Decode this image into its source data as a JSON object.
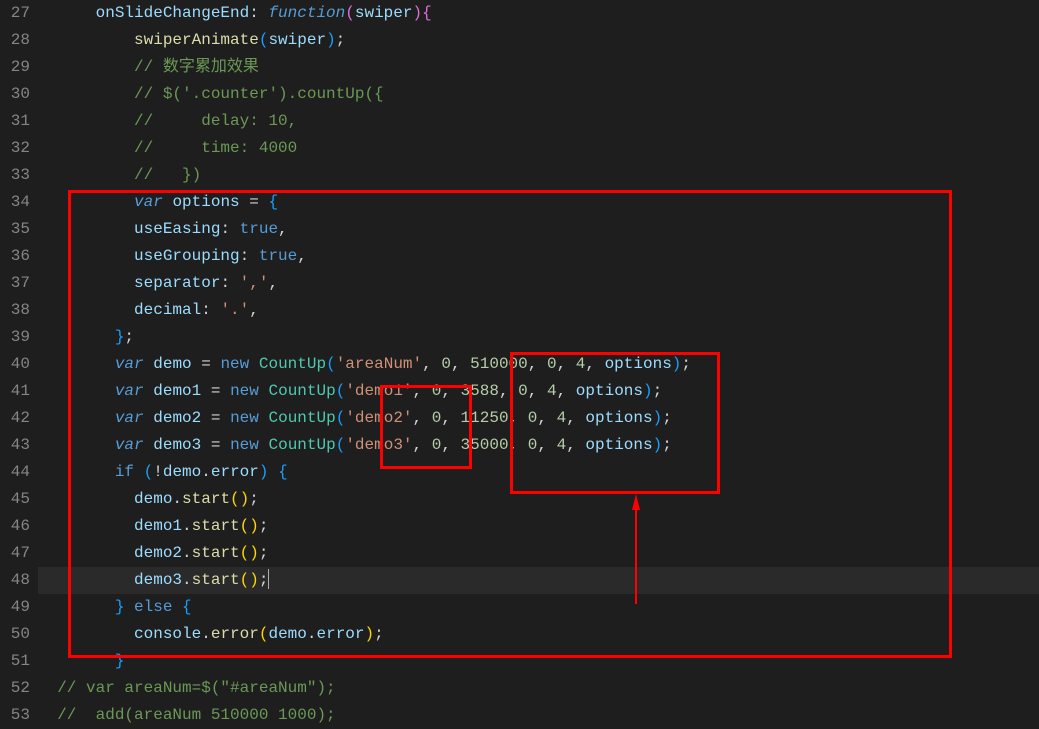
{
  "lines": [
    {
      "num": 27,
      "indent": 3,
      "tokens": [
        {
          "t": "var",
          "c": "onSlideChangeEnd"
        },
        {
          "t": "punc",
          "c": ": "
        },
        {
          "t": "kw",
          "c": "function"
        },
        {
          "t": "paren2",
          "c": "("
        },
        {
          "t": "var",
          "c": "swiper"
        },
        {
          "t": "paren2",
          "c": ")"
        },
        {
          "t": "paren2",
          "c": "{"
        }
      ]
    },
    {
      "num": 28,
      "indent": 5,
      "tokens": [
        {
          "t": "fn",
          "c": "swiperAnimate"
        },
        {
          "t": "paren3",
          "c": "("
        },
        {
          "t": "var",
          "c": "swiper"
        },
        {
          "t": "paren3",
          "c": ")"
        },
        {
          "t": "punc",
          "c": ";"
        }
      ]
    },
    {
      "num": 29,
      "indent": 5,
      "tokens": [
        {
          "t": "com",
          "c": "// 数字累加效果"
        }
      ]
    },
    {
      "num": 30,
      "indent": 5,
      "tokens": [
        {
          "t": "com",
          "c": "// $('.counter').countUp({"
        }
      ]
    },
    {
      "num": 31,
      "indent": 5,
      "tokens": [
        {
          "t": "com",
          "c": "//     delay: 10,"
        }
      ]
    },
    {
      "num": 32,
      "indent": 5,
      "tokens": [
        {
          "t": "com",
          "c": "//     time: 4000"
        }
      ]
    },
    {
      "num": 33,
      "indent": 5,
      "tokens": [
        {
          "t": "com",
          "c": "//   })"
        }
      ]
    },
    {
      "num": 34,
      "indent": 5,
      "tokens": [
        {
          "t": "kw",
          "c": "var"
        },
        {
          "t": "punc",
          "c": " "
        },
        {
          "t": "var",
          "c": "options"
        },
        {
          "t": "punc",
          "c": " = "
        },
        {
          "t": "paren3",
          "c": "{"
        }
      ]
    },
    {
      "num": 35,
      "indent": 5,
      "tokens": [
        {
          "t": "var",
          "c": "useEasing"
        },
        {
          "t": "punc",
          "c": ": "
        },
        {
          "t": "kw2",
          "c": "true"
        },
        {
          "t": "punc",
          "c": ","
        }
      ]
    },
    {
      "num": 36,
      "indent": 5,
      "tokens": [
        {
          "t": "var",
          "c": "useGrouping"
        },
        {
          "t": "punc",
          "c": ": "
        },
        {
          "t": "kw2",
          "c": "true"
        },
        {
          "t": "punc",
          "c": ","
        }
      ]
    },
    {
      "num": 37,
      "indent": 5,
      "tokens": [
        {
          "t": "var",
          "c": "separator"
        },
        {
          "t": "punc",
          "c": ": "
        },
        {
          "t": "str",
          "c": "','"
        },
        {
          "t": "punc",
          "c": ","
        }
      ]
    },
    {
      "num": 38,
      "indent": 5,
      "tokens": [
        {
          "t": "var",
          "c": "decimal"
        },
        {
          "t": "punc",
          "c": ": "
        },
        {
          "t": "str",
          "c": "'.'"
        },
        {
          "t": "punc",
          "c": ","
        }
      ]
    },
    {
      "num": 39,
      "indent": 4,
      "tokens": [
        {
          "t": "paren3",
          "c": "}"
        },
        {
          "t": "punc",
          "c": ";"
        }
      ]
    },
    {
      "num": 40,
      "indent": 4,
      "tokens": [
        {
          "t": "kw",
          "c": "var"
        },
        {
          "t": "punc",
          "c": " "
        },
        {
          "t": "var",
          "c": "demo"
        },
        {
          "t": "punc",
          "c": " = "
        },
        {
          "t": "kw2",
          "c": "new"
        },
        {
          "t": "punc",
          "c": " "
        },
        {
          "t": "cls",
          "c": "CountUp"
        },
        {
          "t": "paren3",
          "c": "("
        },
        {
          "t": "str",
          "c": "'areaNum'"
        },
        {
          "t": "punc",
          "c": ", "
        },
        {
          "t": "num",
          "c": "0"
        },
        {
          "t": "punc",
          "c": ", "
        },
        {
          "t": "num",
          "c": "510000"
        },
        {
          "t": "punc",
          "c": ", "
        },
        {
          "t": "num",
          "c": "0"
        },
        {
          "t": "punc",
          "c": ", "
        },
        {
          "t": "num",
          "c": "4"
        },
        {
          "t": "punc",
          "c": ", "
        },
        {
          "t": "var",
          "c": "options"
        },
        {
          "t": "paren3",
          "c": ")"
        },
        {
          "t": "punc",
          "c": ";"
        }
      ]
    },
    {
      "num": 41,
      "indent": 4,
      "tokens": [
        {
          "t": "kw",
          "c": "var"
        },
        {
          "t": "punc",
          "c": " "
        },
        {
          "t": "var",
          "c": "demo1"
        },
        {
          "t": "punc",
          "c": " = "
        },
        {
          "t": "kw2",
          "c": "new"
        },
        {
          "t": "punc",
          "c": " "
        },
        {
          "t": "cls",
          "c": "CountUp"
        },
        {
          "t": "paren3",
          "c": "("
        },
        {
          "t": "str",
          "c": "'demo1'"
        },
        {
          "t": "punc",
          "c": ", "
        },
        {
          "t": "num",
          "c": "0"
        },
        {
          "t": "punc",
          "c": ", "
        },
        {
          "t": "num",
          "c": "3588"
        },
        {
          "t": "punc",
          "c": ", "
        },
        {
          "t": "num",
          "c": "0"
        },
        {
          "t": "punc",
          "c": ", "
        },
        {
          "t": "num",
          "c": "4"
        },
        {
          "t": "punc",
          "c": ", "
        },
        {
          "t": "var",
          "c": "options"
        },
        {
          "t": "paren3",
          "c": ")"
        },
        {
          "t": "punc",
          "c": ";"
        }
      ]
    },
    {
      "num": 42,
      "indent": 4,
      "tokens": [
        {
          "t": "kw",
          "c": "var"
        },
        {
          "t": "punc",
          "c": " "
        },
        {
          "t": "var",
          "c": "demo2"
        },
        {
          "t": "punc",
          "c": " = "
        },
        {
          "t": "kw2",
          "c": "new"
        },
        {
          "t": "punc",
          "c": " "
        },
        {
          "t": "cls",
          "c": "CountUp"
        },
        {
          "t": "paren3",
          "c": "("
        },
        {
          "t": "str",
          "c": "'demo2'"
        },
        {
          "t": "punc",
          "c": ", "
        },
        {
          "t": "num",
          "c": "0"
        },
        {
          "t": "punc",
          "c": ", "
        },
        {
          "t": "num",
          "c": "11250"
        },
        {
          "t": "punc",
          "c": ", "
        },
        {
          "t": "num",
          "c": "0"
        },
        {
          "t": "punc",
          "c": ", "
        },
        {
          "t": "num",
          "c": "4"
        },
        {
          "t": "punc",
          "c": ", "
        },
        {
          "t": "var",
          "c": "options"
        },
        {
          "t": "paren3",
          "c": ")"
        },
        {
          "t": "punc",
          "c": ";"
        }
      ]
    },
    {
      "num": 43,
      "indent": 4,
      "tokens": [
        {
          "t": "kw",
          "c": "var"
        },
        {
          "t": "punc",
          "c": " "
        },
        {
          "t": "var",
          "c": "demo3"
        },
        {
          "t": "punc",
          "c": " = "
        },
        {
          "t": "kw2",
          "c": "new"
        },
        {
          "t": "punc",
          "c": " "
        },
        {
          "t": "cls",
          "c": "CountUp"
        },
        {
          "t": "paren3",
          "c": "("
        },
        {
          "t": "str",
          "c": "'demo3'"
        },
        {
          "t": "punc",
          "c": ", "
        },
        {
          "t": "num",
          "c": "0"
        },
        {
          "t": "punc",
          "c": ", "
        },
        {
          "t": "num",
          "c": "35000"
        },
        {
          "t": "punc",
          "c": ", "
        },
        {
          "t": "num",
          "c": "0"
        },
        {
          "t": "punc",
          "c": ", "
        },
        {
          "t": "num",
          "c": "4"
        },
        {
          "t": "punc",
          "c": ", "
        },
        {
          "t": "var",
          "c": "options"
        },
        {
          "t": "paren3",
          "c": ")"
        },
        {
          "t": "punc",
          "c": ";"
        }
      ]
    },
    {
      "num": 44,
      "indent": 4,
      "tokens": [
        {
          "t": "kw2",
          "c": "if"
        },
        {
          "t": "punc",
          "c": " "
        },
        {
          "t": "paren3",
          "c": "("
        },
        {
          "t": "punc",
          "c": "!"
        },
        {
          "t": "var",
          "c": "demo"
        },
        {
          "t": "punc",
          "c": "."
        },
        {
          "t": "var",
          "c": "error"
        },
        {
          "t": "paren3",
          "c": ")"
        },
        {
          "t": "punc",
          "c": " "
        },
        {
          "t": "paren3",
          "c": "{"
        }
      ]
    },
    {
      "num": 45,
      "indent": 5,
      "tokens": [
        {
          "t": "var",
          "c": "demo"
        },
        {
          "t": "punc",
          "c": "."
        },
        {
          "t": "fn",
          "c": "start"
        },
        {
          "t": "paren",
          "c": "()"
        },
        {
          "t": "punc",
          "c": ";"
        }
      ]
    },
    {
      "num": 46,
      "indent": 5,
      "tokens": [
        {
          "t": "var",
          "c": "demo1"
        },
        {
          "t": "punc",
          "c": "."
        },
        {
          "t": "fn",
          "c": "start"
        },
        {
          "t": "paren",
          "c": "()"
        },
        {
          "t": "punc",
          "c": ";"
        }
      ]
    },
    {
      "num": 47,
      "indent": 5,
      "tokens": [
        {
          "t": "var",
          "c": "demo2"
        },
        {
          "t": "punc",
          "c": "."
        },
        {
          "t": "fn",
          "c": "start"
        },
        {
          "t": "paren",
          "c": "()"
        },
        {
          "t": "punc",
          "c": ";"
        }
      ]
    },
    {
      "num": 48,
      "indent": 5,
      "hl": true,
      "cursor": true,
      "tokens": [
        {
          "t": "var",
          "c": "demo3"
        },
        {
          "t": "punc",
          "c": "."
        },
        {
          "t": "fn",
          "c": "start"
        },
        {
          "t": "paren",
          "c": "()"
        },
        {
          "t": "punc",
          "c": ";"
        }
      ]
    },
    {
      "num": 49,
      "indent": 4,
      "tokens": [
        {
          "t": "paren3",
          "c": "}"
        },
        {
          "t": "punc",
          "c": " "
        },
        {
          "t": "kw2",
          "c": "else"
        },
        {
          "t": "punc",
          "c": " "
        },
        {
          "t": "paren3",
          "c": "{"
        }
      ]
    },
    {
      "num": 50,
      "indent": 5,
      "tokens": [
        {
          "t": "var",
          "c": "console"
        },
        {
          "t": "punc",
          "c": "."
        },
        {
          "t": "fn",
          "c": "error"
        },
        {
          "t": "paren",
          "c": "("
        },
        {
          "t": "var",
          "c": "demo"
        },
        {
          "t": "punc",
          "c": "."
        },
        {
          "t": "var",
          "c": "error"
        },
        {
          "t": "paren",
          "c": ")"
        },
        {
          "t": "punc",
          "c": ";"
        }
      ]
    },
    {
      "num": 51,
      "indent": 4,
      "tokens": [
        {
          "t": "paren3",
          "c": "}"
        }
      ]
    },
    {
      "num": 52,
      "indent": 1,
      "tokens": [
        {
          "t": "com",
          "c": "// var areaNum=$(\"#areaNum\");"
        }
      ]
    },
    {
      "num": 53,
      "indent": 1,
      "tokens": [
        {
          "t": "com",
          "c": "//  add(areaNum 510000 1000);"
        }
      ]
    }
  ]
}
